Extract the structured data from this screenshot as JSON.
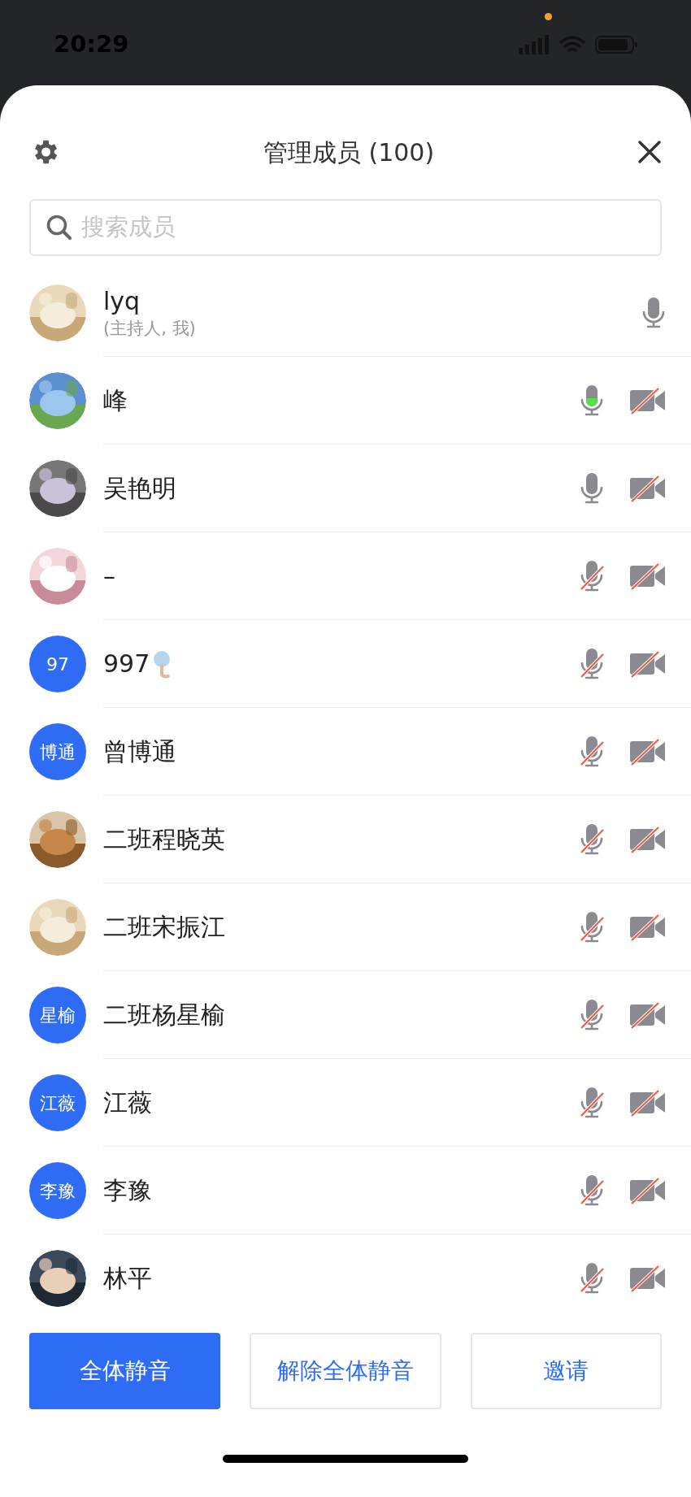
{
  "status_bar": {
    "time": "20:29"
  },
  "header": {
    "title": "管理成员 (100)"
  },
  "search": {
    "placeholder": "搜索成员"
  },
  "members": [
    {
      "name": "lyq",
      "subtitle": "(主持人, 我)",
      "mic": {
        "kind": "on"
      },
      "camera": {
        "kind": "none"
      }
    },
    {
      "name": "峰",
      "mic": {
        "kind": "speaking"
      },
      "camera": {
        "kind": "off"
      }
    },
    {
      "name": "吴艳明",
      "mic": {
        "kind": "on"
      },
      "camera": {
        "kind": "off"
      }
    },
    {
      "name": "–",
      "mic": {
        "kind": "muted"
      },
      "camera": {
        "kind": "off"
      }
    },
    {
      "name": "997",
      "badge": true,
      "avatar": {
        "kind": "initials",
        "text": "97"
      },
      "mic": {
        "kind": "muted"
      },
      "camera": {
        "kind": "off"
      }
    },
    {
      "name": "曾博通",
      "avatar": {
        "kind": "initials",
        "text": "博通"
      },
      "mic": {
        "kind": "muted"
      },
      "camera": {
        "kind": "off"
      }
    },
    {
      "name": "二班程晓英",
      "mic": {
        "kind": "muted"
      },
      "camera": {
        "kind": "off"
      }
    },
    {
      "name": "二班宋振江",
      "mic": {
        "kind": "muted"
      },
      "camera": {
        "kind": "off"
      }
    },
    {
      "name": "二班杨星榆",
      "avatar": {
        "kind": "initials",
        "text": "星榆"
      },
      "mic": {
        "kind": "muted"
      },
      "camera": {
        "kind": "off"
      }
    },
    {
      "name": "江薇",
      "avatar": {
        "kind": "initials",
        "text": "江薇"
      },
      "mic": {
        "kind": "muted"
      },
      "camera": {
        "kind": "off"
      }
    },
    {
      "name": "李豫",
      "avatar": {
        "kind": "initials",
        "text": "李豫"
      },
      "mic": {
        "kind": "muted"
      },
      "camera": {
        "kind": "off"
      }
    },
    {
      "name": "林平",
      "mic": {
        "kind": "muted"
      },
      "camera": {
        "kind": "off"
      }
    }
  ],
  "buttons": [
    {
      "label": "全体静音",
      "kind": "primary"
    },
    {
      "label": "解除全体静音",
      "kind": "secondary"
    },
    {
      "label": "邀请",
      "kind": "secondary"
    }
  ]
}
